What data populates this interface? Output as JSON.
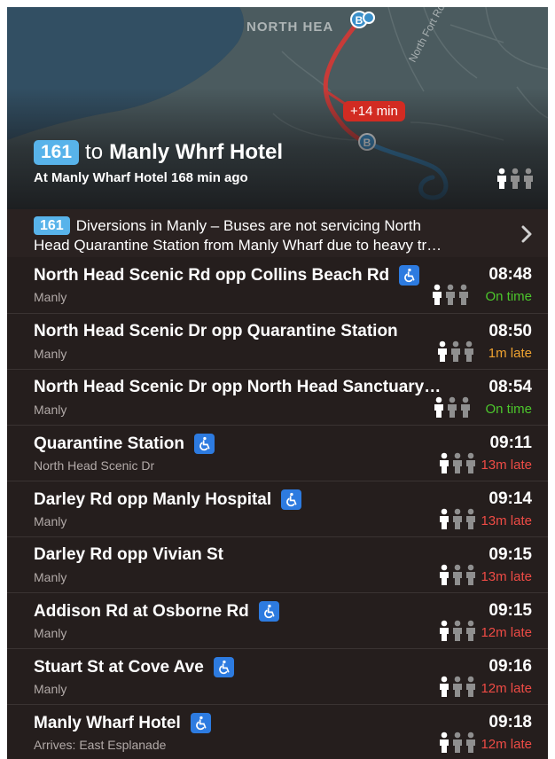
{
  "map": {
    "suburb_label": "NORTH HEA",
    "road_label": "North Fort Rd",
    "delay_pill": "+14 min",
    "marker_letter": "B"
  },
  "route": {
    "number": "161",
    "to_word": "to",
    "destination": "Manly Whrf Hotel",
    "subtitle": "At Manly Wharf Hotel 168 min ago",
    "occupancy_icon": "occupancy-people-icon"
  },
  "alert": {
    "route_number": "161",
    "line1": "Diversions in Manly – Buses are not servicing North",
    "line2": "Head Quarantine Station from Manly Wharf due to heavy tr…",
    "chevron_icon": "chevron-right-icon"
  },
  "colors": {
    "route_badge": "#58b3ea",
    "delay_pill": "#d22b22",
    "on_time": "#4cc62c",
    "slightly_late": "#f0a330",
    "late": "#ee4b45",
    "accessible_badge": "#2d7be0"
  },
  "stops": [
    {
      "name": "North Head Scenic Rd opp Collins Beach Rd",
      "accessible": true,
      "sub": "Manly",
      "time": "08:48",
      "status": "On time",
      "status_kind": "on_time"
    },
    {
      "name": "North Head Scenic Dr opp Quarantine Station",
      "accessible": false,
      "sub": "Manly",
      "time": "08:50",
      "status": "1m late",
      "status_kind": "slightly_late"
    },
    {
      "name": "North Head Scenic Dr opp North Head Sanctuary…",
      "accessible": false,
      "sub": "Manly",
      "time": "08:54",
      "status": "On time",
      "status_kind": "on_time"
    },
    {
      "name": "Quarantine Station",
      "accessible": true,
      "sub": "North Head Scenic Dr",
      "time": "09:11",
      "status": "13m late",
      "status_kind": "late"
    },
    {
      "name": "Darley Rd opp Manly Hospital",
      "accessible": true,
      "sub": "Manly",
      "time": "09:14",
      "status": "13m late",
      "status_kind": "late"
    },
    {
      "name": "Darley Rd opp Vivian St",
      "accessible": false,
      "sub": "Manly",
      "time": "09:15",
      "status": "13m late",
      "status_kind": "late"
    },
    {
      "name": "Addison Rd at Osborne Rd",
      "accessible": true,
      "sub": "Manly",
      "time": "09:15",
      "status": "12m late",
      "status_kind": "late"
    },
    {
      "name": "Stuart St at Cove Ave",
      "accessible": true,
      "sub": "Manly",
      "time": "09:16",
      "status": "12m late",
      "status_kind": "late"
    },
    {
      "name": "Manly Wharf Hotel",
      "accessible": true,
      "sub": "Arrives: East Esplanade",
      "time": "09:18",
      "status": "12m late",
      "status_kind": "late"
    }
  ]
}
